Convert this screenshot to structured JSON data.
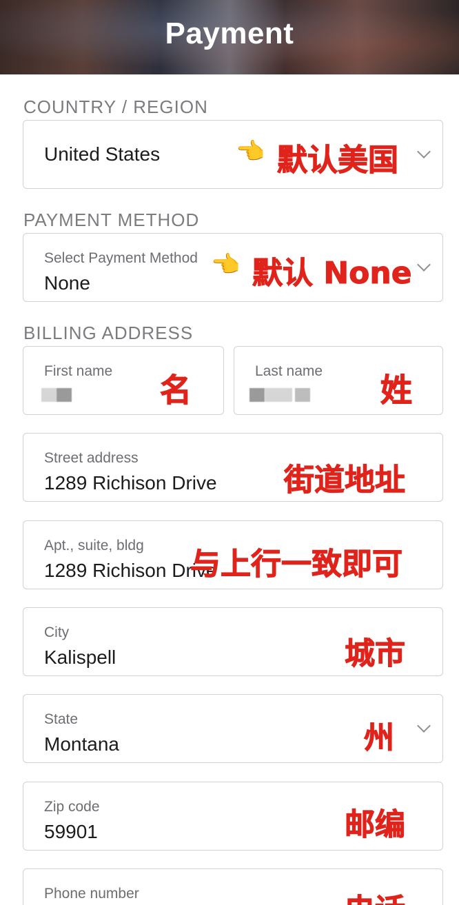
{
  "header": {
    "title": "Payment"
  },
  "sections": {
    "country": "COUNTRY / REGION",
    "payment": "PAYMENT METHOD",
    "billing": "BILLING ADDRESS"
  },
  "country_field": {
    "value": "United States",
    "annotation": "默认美国"
  },
  "payment_field": {
    "label": "Select Payment Method",
    "value": "None",
    "annotation": "默认 None"
  },
  "first_name": {
    "label": "First name",
    "annotation": "名"
  },
  "last_name": {
    "label": "Last name",
    "annotation": "姓"
  },
  "street": {
    "label": "Street address",
    "value": "1289 Richison Drive",
    "annotation": "街道地址"
  },
  "apt": {
    "label": "Apt., suite, bldg",
    "value": "1289 Richison Drive",
    "annotation": "与上行一致即可"
  },
  "city": {
    "label": "City",
    "value": "Kalispell",
    "annotation": "城市"
  },
  "state": {
    "label": "State",
    "value": "Montana",
    "annotation": "州"
  },
  "zip": {
    "label": "Zip code",
    "value": "59901",
    "annotation": "邮编"
  },
  "phone": {
    "label": "Phone number",
    "annotation": "电话"
  },
  "icons": {
    "pointer": "backhand-index-pointing-right-icon",
    "dropdown": "chevron-down-icon"
  },
  "colors": {
    "annotation": "#e0231b",
    "label": "#7c7c80",
    "border": "#d1d1d6"
  }
}
